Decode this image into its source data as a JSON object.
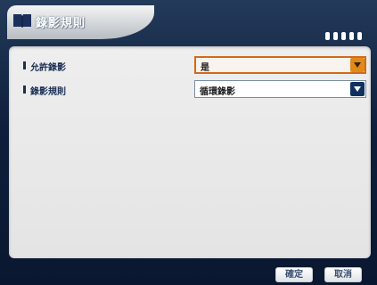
{
  "header": {
    "title": "錄影規則",
    "icon": "book-icon",
    "indicator_dots": 5
  },
  "settings": [
    {
      "label": "允許錄影",
      "value": "是",
      "active": true
    },
    {
      "label": "錄影規則",
      "value": "循環錄影",
      "active": false
    }
  ],
  "footer": {
    "confirm_label": "確定",
    "cancel_label": "取消"
  },
  "colors": {
    "background": "#0b1830",
    "panel": "#eeeeee",
    "accent": "#e08a1a",
    "arrow": "#10305f",
    "label": "#1b2f55"
  }
}
